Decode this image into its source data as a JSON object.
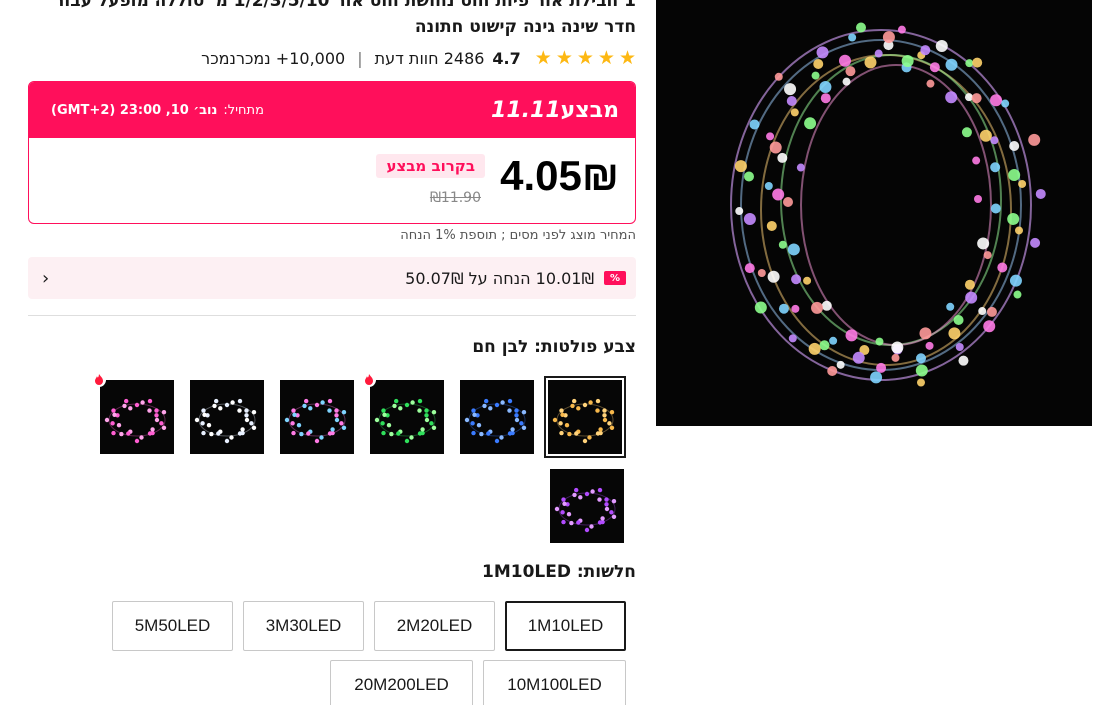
{
  "product": {
    "title": "1 חבילת אור פיות חוט נחושת חוט אור 1/2/3/5/10 מ' סוללה מופעל עבור חדר שינה גינה קישוט חתונה",
    "rating": {
      "score": "4.7",
      "reviews": "2486 חוות דעת",
      "sold": "10,000+ נמכרנמכר",
      "stars": 5
    },
    "image_icon": "fairy-light-ring-photo"
  },
  "deal": {
    "brand_text": "מבצע",
    "brand_num": "11.11",
    "start_label": "מתחיל:",
    "start_value": "נוב׳ 10, 23:00 (GMT+2)",
    "price": "4.05₪",
    "old_price": "₪11.90",
    "soon_badge": "בקרוב מבצע",
    "tax_note": "המחיר מוצג לפני מסים ; תוספת 1% הנחה",
    "coupon_icon": "%",
    "coupon_text": "10.01₪ הנחה על 50.07₪",
    "colors": {
      "accent": "#ff0f5b",
      "star": "#fdb813"
    }
  },
  "color_option": {
    "title": "צבע פולטות: לבן חם",
    "variants": [
      {
        "name": "warm-white",
        "hot": false
      },
      {
        "name": "blue",
        "hot": false
      },
      {
        "name": "green",
        "hot": true
      },
      {
        "name": "multicolor",
        "hot": false
      },
      {
        "name": "white",
        "hot": false
      },
      {
        "name": "pink",
        "hot": true
      },
      {
        "name": "purple",
        "hot": false
      }
    ]
  },
  "size_option": {
    "title": "חלשות: 1M10LED",
    "values": [
      "1M10LED",
      "2M20LED",
      "3M30LED",
      "5M50LED",
      "10M100LED",
      "20M200LED"
    ],
    "selected": "1M10LED"
  }
}
